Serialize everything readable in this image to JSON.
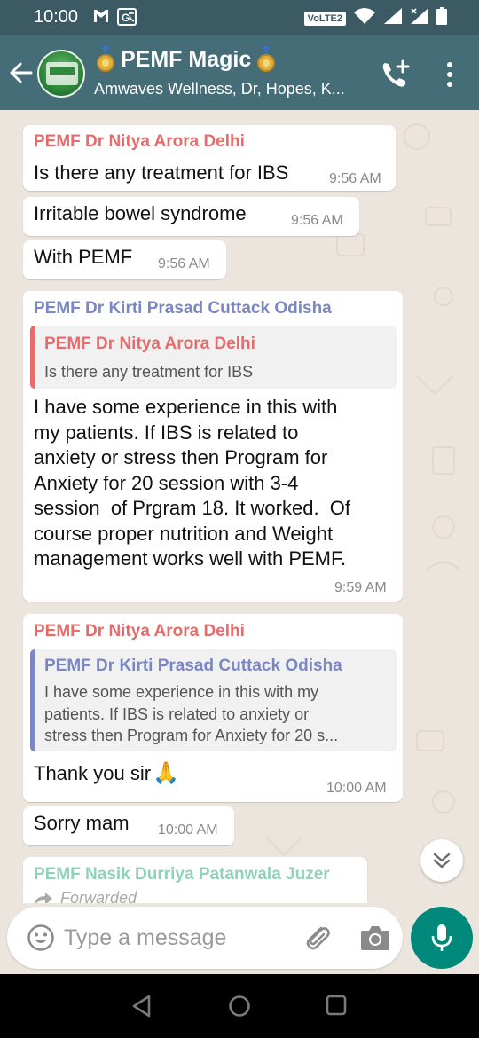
{
  "status_bar": {
    "time": "10:00",
    "network_label": "VoLTE2",
    "icons": [
      "gmail-icon",
      "translate-icon",
      "volte-badge",
      "wifi-icon",
      "signal-icon",
      "signal-icon",
      "battery-icon"
    ]
  },
  "header": {
    "title": "PEMF Magic",
    "subtitle": "Amwaves Wellness, Dr, Hopes, K...",
    "icons": [
      "back-arrow-icon",
      "group-avatar",
      "medal-icon",
      "add-call-icon",
      "more-vert-icon"
    ]
  },
  "messages": [
    {
      "sender": "PEMF Dr Nitya Arora Delhi",
      "text": "Is there any treatment for IBS",
      "time": "9:56 AM"
    },
    {
      "text": "Irritable bowel syndrome",
      "time": "9:56 AM"
    },
    {
      "text": "With PEMF",
      "time": "9:56 AM"
    },
    {
      "sender": "PEMF Dr Kirti Prasad Cuttack Odisha",
      "quote": {
        "sender": "PEMF Dr Nitya Arora Delhi",
        "text": "Is there any treatment for IBS"
      },
      "lines": [
        "I have some experience in this with",
        "my patients. If IBS is related to",
        "anxiety or stress then Program for",
        "Anxiety for 20 session with 3-4",
        "session  of Prgram 18. It worked.  Of",
        "course proper nutrition and Weight",
        "management works well with PEMF."
      ],
      "time": "9:59 AM"
    },
    {
      "sender": "PEMF Dr Nitya Arora Delhi",
      "quote": {
        "sender": "PEMF Dr Kirti Prasad Cuttack Odisha",
        "lines": [
          "I have some experience in this with my",
          "patients. If IBS is related to anxiety or",
          "stress then Program for Anxiety for 20 s..."
        ]
      },
      "text": "Thank you sir",
      "emoji": "🙏",
      "time": "10:00 AM"
    },
    {
      "text": "Sorry mam",
      "time": "10:00 AM"
    },
    {
      "sender": "PEMF Nasik Durriya Patanwala Juzer",
      "forwarded": "Forwarded"
    }
  ],
  "input": {
    "placeholder": "Type a message"
  },
  "colors": {
    "status_bar": "#3c5a63",
    "header": "#456d77",
    "chat_bg": "#ece5dd",
    "sender_nitya": "#e86b6b",
    "sender_kirti": "#7b86c4",
    "sender_nasik": "#8fd3b8",
    "accent": "#00897b"
  }
}
